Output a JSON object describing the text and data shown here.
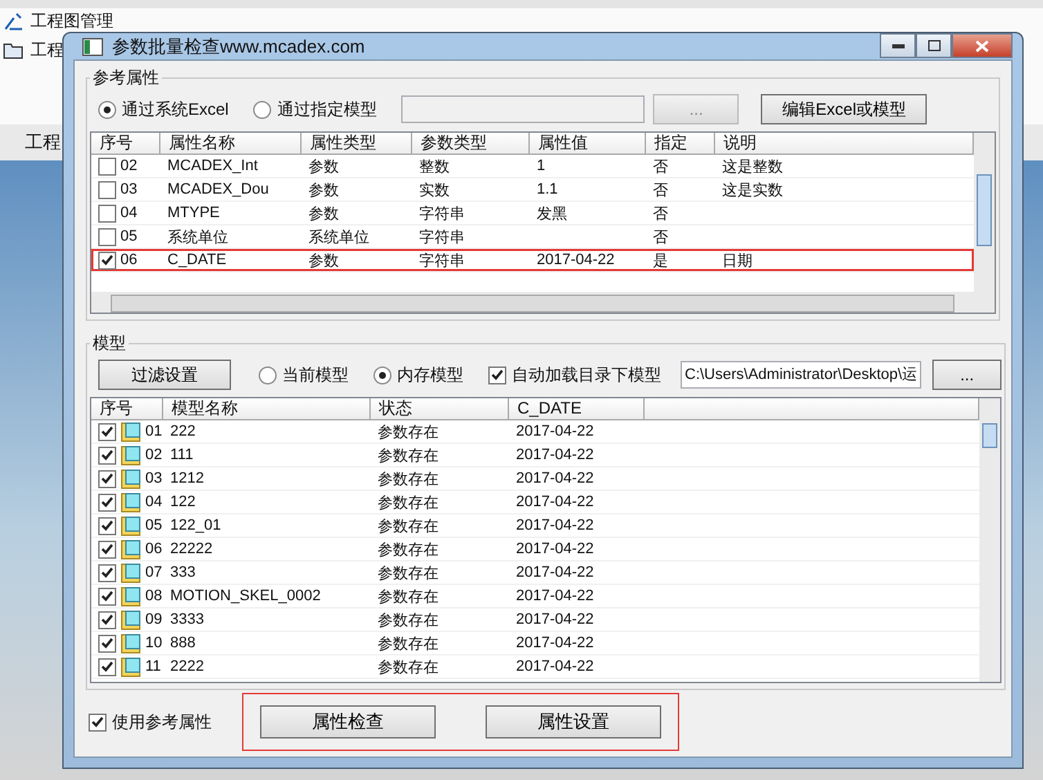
{
  "background_app": {
    "ribbon_label": "工程图管理",
    "side_labels": [
      "工程",
      "工程"
    ]
  },
  "dialog": {
    "title": "参数批量检查www.mcadex.com",
    "reference": {
      "title": "参考属性",
      "sources": [
        {
          "label": "通过系统Excel",
          "selected": true
        },
        {
          "label": "通过指定模型",
          "selected": false
        }
      ],
      "browse_button": "...",
      "edit_button": "编辑Excel或模型",
      "columns": [
        "序号",
        "属性名称",
        "属性类型",
        "参数类型",
        "属性值",
        "指定",
        "说明"
      ],
      "rows": [
        {
          "checked": false,
          "highlighted": false,
          "cells": [
            "02",
            "MCADEX_Int",
            "参数",
            "整数",
            "1",
            "否",
            "这是整数"
          ]
        },
        {
          "checked": false,
          "highlighted": false,
          "cells": [
            "03",
            "MCADEX_Dou",
            "参数",
            "实数",
            "1.1",
            "否",
            "这是实数"
          ]
        },
        {
          "checked": false,
          "highlighted": false,
          "cells": [
            "04",
            "MTYPE",
            "参数",
            "字符串",
            "发黑",
            "否",
            ""
          ]
        },
        {
          "checked": false,
          "highlighted": false,
          "cells": [
            "05",
            "系统单位",
            "系统单位",
            "字符串",
            "",
            "否",
            ""
          ]
        },
        {
          "checked": true,
          "highlighted": true,
          "cells": [
            "06",
            "C_DATE",
            "参数",
            "字符串",
            "2017-04-22",
            "是",
            "日期"
          ]
        }
      ]
    },
    "models": {
      "title": "模型",
      "filter_button": "过滤设置",
      "sources": [
        {
          "label": "当前模型",
          "selected": false
        },
        {
          "label": "内存模型",
          "selected": true
        }
      ],
      "autoload": {
        "label": "自动加载目录下模型",
        "checked": true
      },
      "path": "C:\\Users\\Administrator\\Desktop\\运",
      "browse_button": "...",
      "columns": [
        "序号",
        "模型名称",
        "状态",
        "C_DATE"
      ],
      "rows": [
        {
          "checked": true,
          "cells": [
            "01",
            "222",
            "参数存在",
            "2017-04-22"
          ]
        },
        {
          "checked": true,
          "cells": [
            "02",
            "111",
            "参数存在",
            "2017-04-22"
          ]
        },
        {
          "checked": true,
          "cells": [
            "03",
            "1212",
            "参数存在",
            "2017-04-22"
          ]
        },
        {
          "checked": true,
          "cells": [
            "04",
            "122",
            "参数存在",
            "2017-04-22"
          ]
        },
        {
          "checked": true,
          "cells": [
            "05",
            "122_01",
            "参数存在",
            "2017-04-22"
          ]
        },
        {
          "checked": true,
          "cells": [
            "06",
            "22222",
            "参数存在",
            "2017-04-22"
          ]
        },
        {
          "checked": true,
          "cells": [
            "07",
            "333",
            "参数存在",
            "2017-04-22"
          ]
        },
        {
          "checked": true,
          "cells": [
            "08",
            "MOTION_SKEL_0002",
            "参数存在",
            "2017-04-22"
          ]
        },
        {
          "checked": true,
          "cells": [
            "09",
            "3333",
            "参数存在",
            "2017-04-22"
          ]
        },
        {
          "checked": true,
          "cells": [
            "10",
            "888",
            "参数存在",
            "2017-04-22"
          ]
        },
        {
          "checked": true,
          "cells": [
            "11",
            "2222",
            "参数存在",
            "2017-04-22"
          ]
        }
      ]
    },
    "use_reference": {
      "label": "使用参考属性",
      "checked": true
    },
    "buttons": [
      "属性检查",
      "属性设置"
    ],
    "buttons_highlighted": true
  }
}
